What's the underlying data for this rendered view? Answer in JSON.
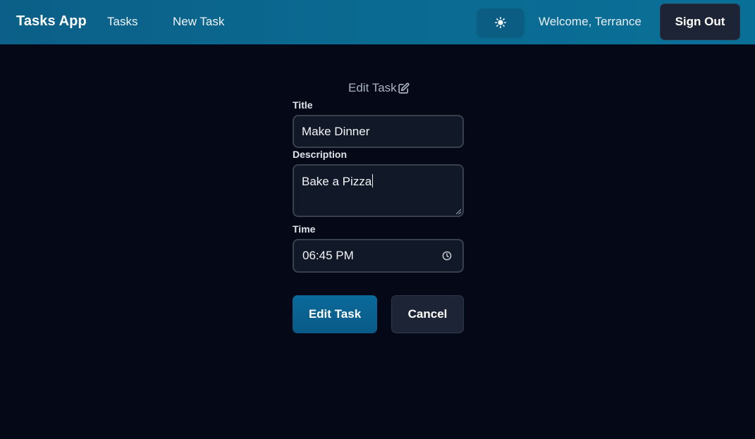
{
  "navbar": {
    "brand": "Tasks App",
    "links": [
      {
        "label": "Tasks"
      },
      {
        "label": "New Task"
      }
    ],
    "theme_toggle_icon": "sun-icon",
    "welcome": "Welcome, Terrance",
    "sign_out_label": "Sign Out"
  },
  "form": {
    "heading": "Edit Task",
    "heading_icon": "edit-icon",
    "title_label": "Title",
    "title_value": "Make Dinner",
    "description_label": "Description",
    "description_value": "Bake a Pizza",
    "time_label": "Time",
    "time_value": "06:45 PM",
    "submit_label": "Edit Task",
    "cancel_label": "Cancel"
  },
  "colors": {
    "navbar": "#0b6a91",
    "background": "#050816",
    "primary_button": "#0a6a9b",
    "secondary_button": "#1c2436",
    "input_background": "#111827"
  }
}
